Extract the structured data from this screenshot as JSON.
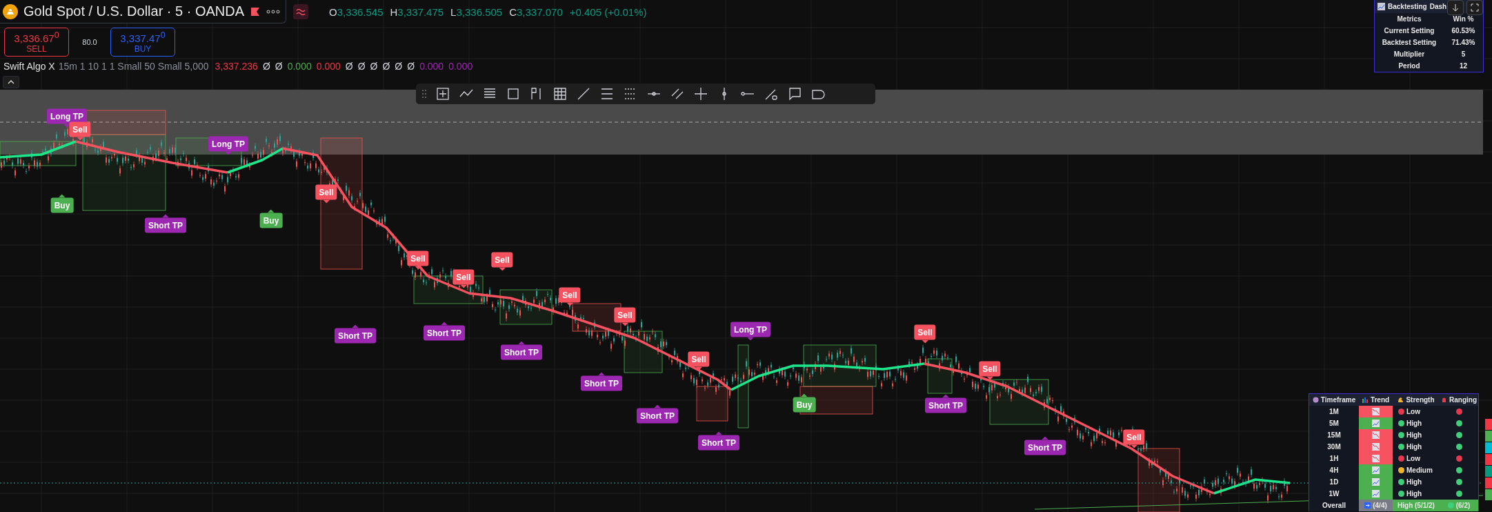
{
  "symbol": {
    "title": "Gold Spot / U.S. Dollar · 5 · OANDA"
  },
  "ohlc": [
    {
      "key": "O",
      "value": "3,336.545"
    },
    {
      "key": "H",
      "value": "3,337.475"
    },
    {
      "key": "L",
      "value": "3,336.505"
    },
    {
      "key": "C",
      "value": "3,337.070"
    }
  ],
  "change": "+0.405 (+0.01%)",
  "trade": {
    "sell_price": "3,336.67$^{0}$",
    "sell_label": "SELL",
    "spread": "80.0",
    "buy_price": "3,337.47$^{0}$",
    "buy_label": "BUY"
  },
  "indicator": {
    "name": "Swift Algo X",
    "params": "15m 1 10 1 1 Small 50 Small 5,000",
    "values": [
      {
        "text": "3,337.236",
        "color": "#f23645"
      },
      {
        "text": "Ø",
        "color": "#d1d4dc"
      },
      {
        "text": "Ø",
        "color": "#d1d4dc"
      },
      {
        "text": "0.000",
        "color": "#4caf50"
      },
      {
        "text": "0.000",
        "color": "#f23645"
      },
      {
        "text": "Ø",
        "color": "#d1d4dc"
      },
      {
        "text": "Ø",
        "color": "#d1d4dc"
      },
      {
        "text": "Ø",
        "color": "#d1d4dc"
      },
      {
        "text": "Ø",
        "color": "#d1d4dc"
      },
      {
        "text": "Ø",
        "color": "#d1d4dc"
      },
      {
        "text": "Ø",
        "color": "#d1d4dc"
      },
      {
        "text": "0.000",
        "color": "#9c27b0"
      },
      {
        "text": "0.000",
        "color": "#9c27b0"
      }
    ]
  },
  "signals": [
    {
      "kind": "long_tp",
      "label": "Long TP"
    },
    {
      "kind": "sell",
      "label": "Sell"
    },
    {
      "kind": "buy",
      "label": "Buy"
    },
    {
      "kind": "long_tp",
      "label": "Long TP"
    },
    {
      "kind": "short_tp",
      "label": "Short TP"
    },
    {
      "kind": "buy",
      "label": "Buy"
    },
    {
      "kind": "sell",
      "label": "Sell"
    },
    {
      "kind": "sell",
      "label": "Sell"
    },
    {
      "kind": "sell",
      "label": "Sell"
    },
    {
      "kind": "sell",
      "label": "Sell"
    },
    {
      "kind": "sell",
      "label": "Sell"
    },
    {
      "kind": "sell",
      "label": "Sell"
    },
    {
      "kind": "short_tp",
      "label": "Short TP"
    },
    {
      "kind": "short_tp",
      "label": "Short TP"
    },
    {
      "kind": "short_tp",
      "label": "Short TP"
    },
    {
      "kind": "short_tp",
      "label": "Short TP"
    },
    {
      "kind": "sell",
      "label": "Sell"
    },
    {
      "kind": "long_tp",
      "label": "Long TP"
    },
    {
      "kind": "short_tp",
      "label": "Short TP"
    },
    {
      "kind": "short_tp",
      "label": "Short TP"
    },
    {
      "kind": "buy",
      "label": "Buy"
    },
    {
      "kind": "sell",
      "label": "Sell"
    },
    {
      "kind": "sell",
      "label": "Sell"
    },
    {
      "kind": "short_tp",
      "label": "Short TP"
    },
    {
      "kind": "short_tp",
      "label": "Short TP"
    },
    {
      "kind": "sell",
      "label": "Sell"
    }
  ],
  "backtest": {
    "title": "Backtesting",
    "title_cut": "Dash",
    "header": [
      "Metrics",
      "Win %"
    ],
    "rows": [
      {
        "label": "Current Setting",
        "value": "60.53%"
      },
      {
        "label": "Backtest Setting",
        "value": "71.43%"
      },
      {
        "label": "Multiplier",
        "value": "5"
      },
      {
        "label": "Period",
        "value": "12"
      }
    ]
  },
  "timeframes": {
    "columns": [
      "Timeframe",
      "Trend",
      "Strength",
      "Ranging"
    ],
    "rows": [
      {
        "tf": "1M",
        "trend_up": false,
        "strength": {
          "text": "Low",
          "color": "#e53950"
        },
        "ranging": {
          "color": "#e53950"
        }
      },
      {
        "tf": "5M",
        "trend_up": true,
        "strength": {
          "text": "High",
          "color": "#3ecf7a"
        },
        "ranging": {
          "color": "#3ecf7a"
        }
      },
      {
        "tf": "15M",
        "trend_up": false,
        "strength": {
          "text": "High",
          "color": "#3ecf7a"
        },
        "ranging": {
          "color": "#3ecf7a"
        }
      },
      {
        "tf": "30M",
        "trend_up": false,
        "strength": {
          "text": "High",
          "color": "#3ecf7a"
        },
        "ranging": {
          "color": "#3ecf7a"
        }
      },
      {
        "tf": "1H",
        "trend_up": false,
        "strength": {
          "text": "Low",
          "color": "#e53950"
        },
        "ranging": {
          "color": "#e53950"
        }
      },
      {
        "tf": "4H",
        "trend_up": true,
        "strength": {
          "text": "Medium",
          "color": "#f0b429"
        },
        "ranging": {
          "color": "#3ecf7a"
        }
      },
      {
        "tf": "1D",
        "trend_up": true,
        "strength": {
          "text": "High",
          "color": "#3ecf7a"
        },
        "ranging": {
          "color": "#3ecf7a"
        }
      },
      {
        "tf": "1W",
        "trend_up": true,
        "strength": {
          "text": "High",
          "color": "#3ecf7a"
        },
        "ranging": {
          "color": "#3ecf7a"
        }
      }
    ],
    "overall": {
      "label": "Overall",
      "trend": "(4/4)",
      "strength": "High (5/1/2)",
      "ranging": {
        "text": "(6/2)",
        "color": "#3ecf7a"
      }
    }
  }
}
